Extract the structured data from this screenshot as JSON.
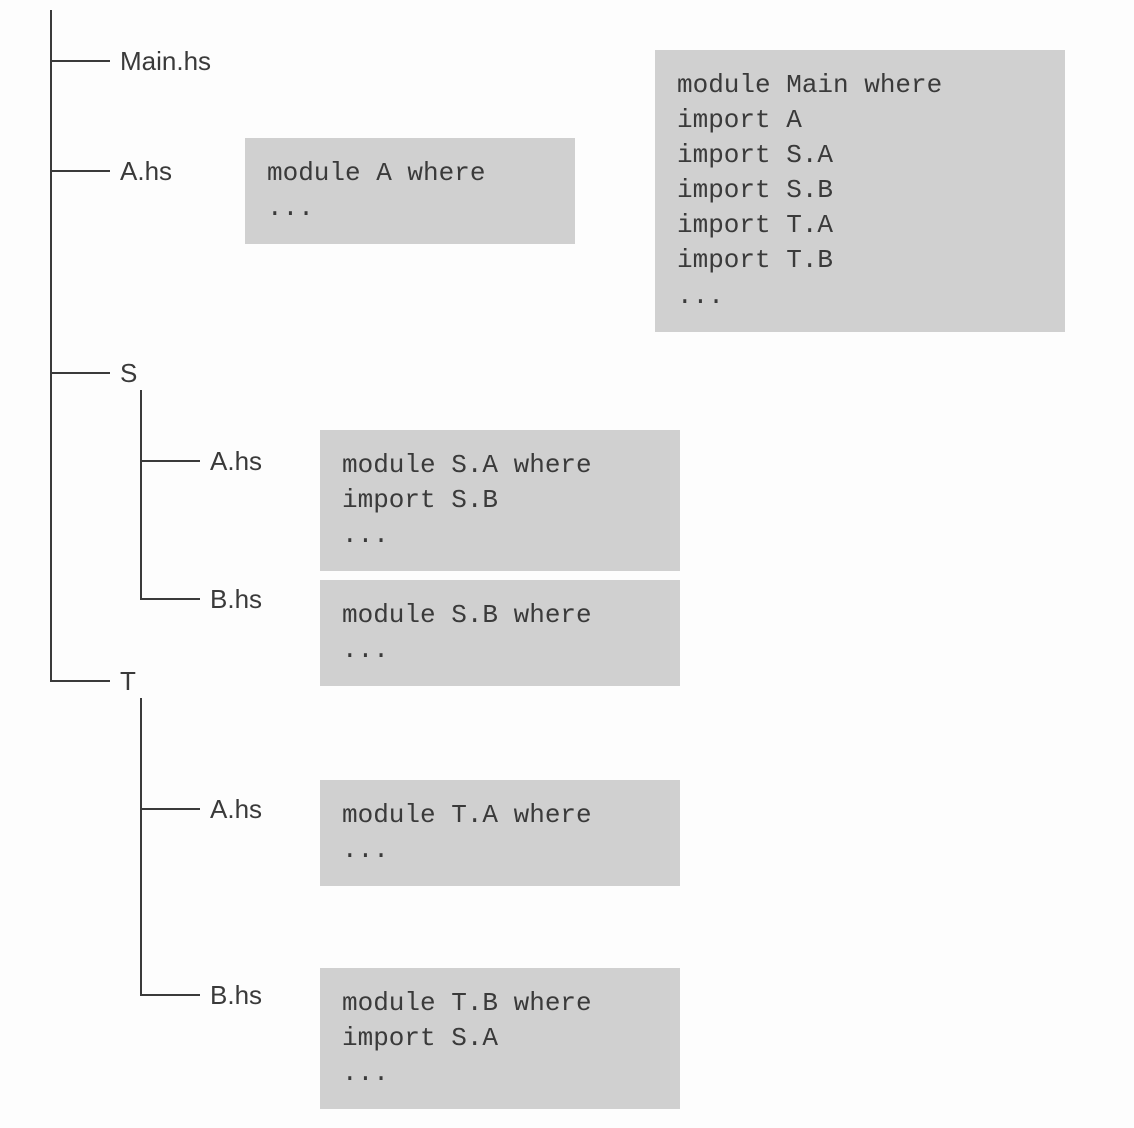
{
  "tree": {
    "main": "Main.hs",
    "a": "A.hs",
    "s": "S",
    "s_a": "A.hs",
    "s_b": "B.hs",
    "t": "T",
    "t_a": "A.hs",
    "t_b": "B.hs"
  },
  "code": {
    "main": "module Main where\nimport A\nimport S.A\nimport S.B\nimport T.A\nimport T.B\n...",
    "a": "module A where\n...",
    "s_a": "module S.A where\nimport S.B\n...",
    "s_b": "module S.B where\n...",
    "t_a": "module T.A where\n...",
    "t_b": "module T.B where\nimport S.A\n..."
  }
}
